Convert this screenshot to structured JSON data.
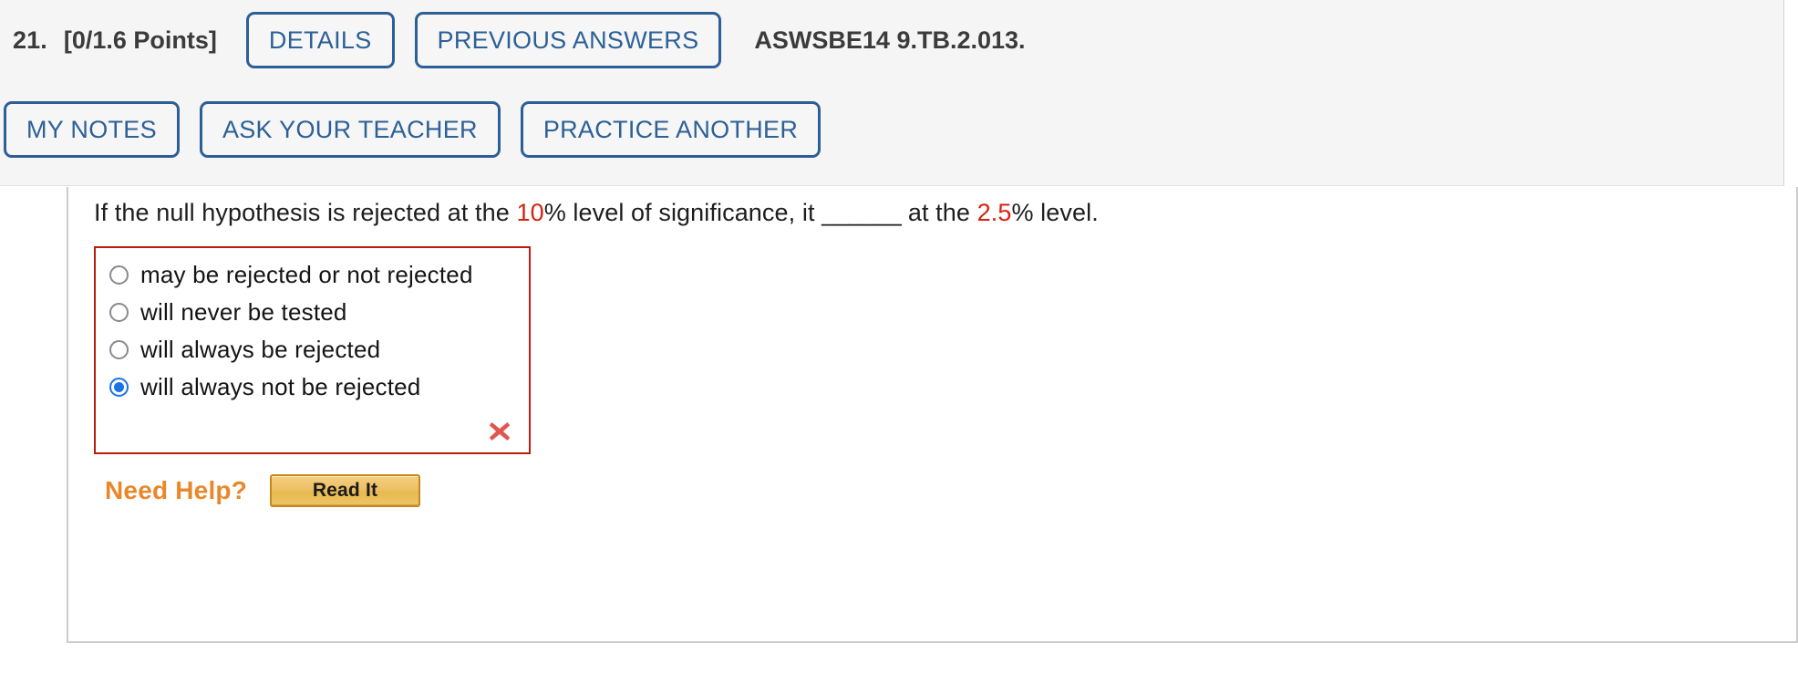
{
  "header": {
    "question_number": "21.",
    "points": "[0/1.6 Points]",
    "buttons_row1": [
      {
        "name": "details-button",
        "label": "DETAILS"
      },
      {
        "name": "previous-answers-button",
        "label": "PREVIOUS ANSWERS"
      }
    ],
    "problem_code": "ASWSBE14 9.TB.2.013.",
    "buttons_row2": [
      {
        "name": "my-notes-button",
        "label": "MY NOTES"
      },
      {
        "name": "ask-your-teacher-button",
        "label": "ASK YOUR TEACHER"
      },
      {
        "name": "practice-another-button",
        "label": "PRACTICE ANOTHER"
      }
    ]
  },
  "question": {
    "part_1": "If the null hypothesis is rejected at the ",
    "value_1": "10",
    "part_2": "% level of significance, it ",
    "blank": "______",
    "part_3": " at the ",
    "value_2": "2.5",
    "part_4": "% level."
  },
  "answers": {
    "options": [
      {
        "label": "may be rejected or not rejected",
        "selected": false
      },
      {
        "label": "will never be tested",
        "selected": false
      },
      {
        "label": "will always be rejected",
        "selected": false
      },
      {
        "label": "will always not be rejected",
        "selected": true
      }
    ],
    "result_icon": "x-mark-incorrect-icon",
    "border_color": "#b91c0c"
  },
  "need_help": {
    "label": "Need Help?",
    "read_it_label": "Read It",
    "label_color": "#e8882b"
  },
  "colors": {
    "accent_blue": "#2c5f96",
    "header_bg": "#f5f5f5",
    "highlight_red": "#d6220f",
    "radio_selected": "#1a73e8",
    "x_mark": "#e0574f"
  }
}
